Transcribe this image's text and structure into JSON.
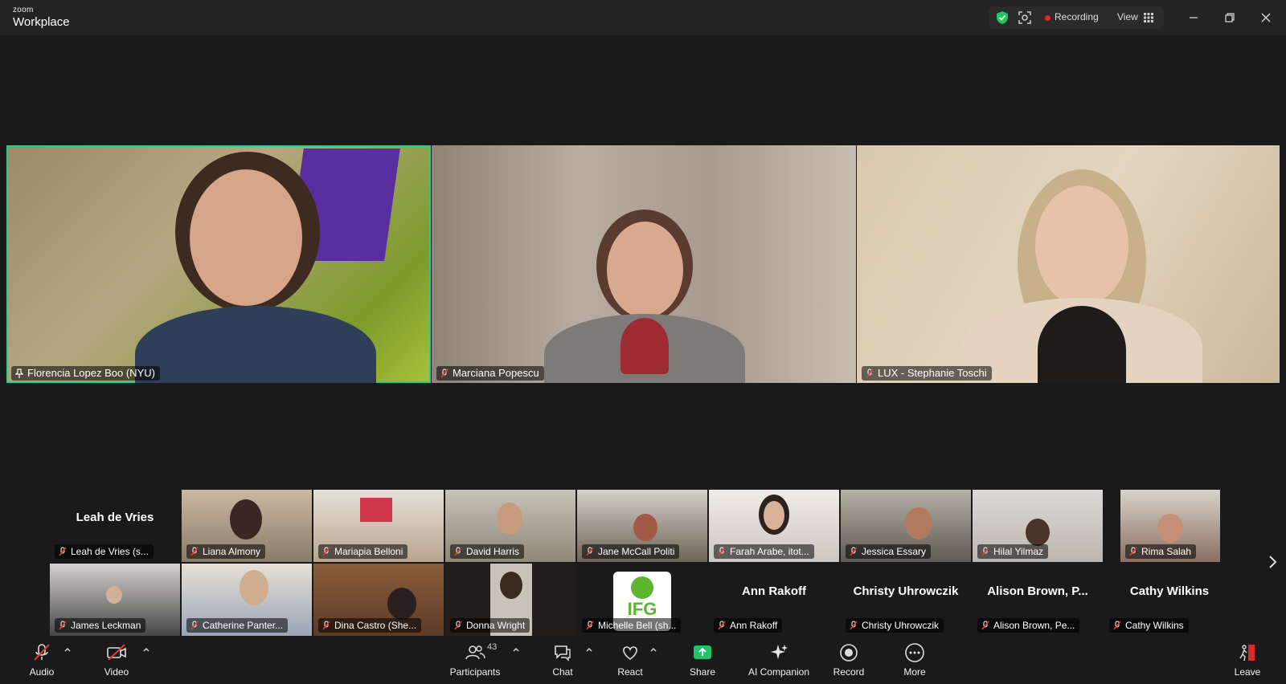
{
  "app": {
    "brand_small": "zoom",
    "brand_name": "Workplace"
  },
  "status": {
    "recording_label": "Recording",
    "view_label": "View"
  },
  "colors": {
    "active_speaker": "#23d18b",
    "recording": "#e02828",
    "shield": "#22c55e",
    "share": "#21c36b",
    "muted": "#e03b3b"
  },
  "speakers": [
    {
      "name": "Florencia Lopez Boo (NYU)",
      "icon": "pin-icon",
      "active": true
    },
    {
      "name": "Marciana Popescu",
      "icon": "mic-muted-icon"
    },
    {
      "name": "LUX - Stephanie Toschi",
      "icon": "mic-muted-icon"
    }
  ],
  "gallery_row1": [
    {
      "name": "Leah de Vries (s...",
      "big_name": "Leah de Vries"
    },
    {
      "name": "Liana Almony"
    },
    {
      "name": "Mariapia Belloni"
    },
    {
      "name": "David Harris"
    },
    {
      "name": "Jane McCall Politi"
    },
    {
      "name": "Farah Arabe, itot..."
    },
    {
      "name": "Jessica Essary"
    },
    {
      "name": "Hilal Yilmaz"
    },
    {
      "name": "Rima Salah"
    }
  ],
  "gallery_row2": [
    {
      "name": "James Leckman"
    },
    {
      "name": "Catherine Panter..."
    },
    {
      "name": "Dina Castro (She..."
    },
    {
      "name": "Donna Wright"
    },
    {
      "name": "Michelle Bell (sh...",
      "logo_text": "IFG"
    },
    {
      "name": "Ann Rakoff",
      "big_name": "Ann Rakoff"
    },
    {
      "name": "Christy Uhrowczik",
      "big_name": "Christy Uhrowczik"
    },
    {
      "name": "Alison Brown, Pe...",
      "big_name": "Alison Brown, P..."
    },
    {
      "name": "Cathy Wilkins",
      "big_name": "Cathy Wilkins"
    }
  ],
  "toolbar": {
    "audio": "Audio",
    "video": "Video",
    "participants": "Participants",
    "participants_count": "43",
    "chat": "Chat",
    "react": "React",
    "share": "Share",
    "ai_companion": "AI Companion",
    "record": "Record",
    "more": "More",
    "leave": "Leave"
  }
}
